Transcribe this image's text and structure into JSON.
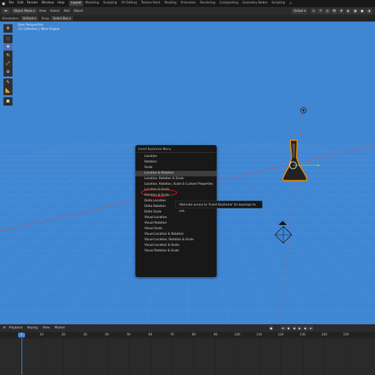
{
  "topbar": {
    "menus": [
      "File",
      "Edit",
      "Render",
      "Window",
      "Help"
    ],
    "workspaces": [
      "Layout",
      "Modeling",
      "Sculpting",
      "UV Editing",
      "Texture Paint",
      "Shading",
      "Animation",
      "Rendering",
      "Compositing",
      "Geometry Nodes",
      "Scripting"
    ],
    "active_workspace": "Layout",
    "add_tab": "+"
  },
  "viewport_header": {
    "mode": "Object Mode",
    "menus": [
      "View",
      "Select",
      "Add",
      "Object"
    ],
    "transform_orientation": "Global"
  },
  "tool_header": {
    "orientation_label": "Orientation:",
    "orientation_value": "Default",
    "drag_label": "Drag:",
    "drag_value": "Select Box"
  },
  "viewport": {
    "perspective": "User Perspective",
    "context": "(1) Collection | Wine Engine",
    "background_color": "#3f86d3"
  },
  "toolbar": {
    "tools": [
      "cursor-icon",
      "select-icon",
      "move-icon",
      "rotate-icon",
      "scale-icon",
      "transform-icon",
      "annotate-icon",
      "measure-icon",
      "add-cube-icon"
    ],
    "active_tool": "move-icon"
  },
  "keyframe_menu": {
    "title": "Insert Keyframe Menu",
    "items": [
      "Location",
      "Rotation",
      "Scale",
      "Location & Rotation",
      "Location, Rotation & Scale",
      "Location, Rotation, Scale & Custom Properties",
      "Location & Scale",
      "Rotation & Scale",
      "Delta Location",
      "Delta Rotation",
      "Delta Scale",
      "Visual Location",
      "Visual Rotation",
      "Visual Scale",
      "Visual Location & Rotation",
      "Visual Location, Rotation & Scale",
      "Visual Location & Scale",
      "Visual Rotation & Scale"
    ],
    "highlighted_index": 3
  },
  "tooltip": {
    "text": "Alternate access to 'Insert Keyframe' for keymaps to use."
  },
  "timeline": {
    "menus": [
      "Playback",
      "Keying",
      "View",
      "Marker"
    ],
    "current_frame": "1",
    "ticks": [
      "10",
      "20",
      "30",
      "40",
      "50",
      "60",
      "70",
      "80",
      "90",
      "100",
      "110",
      "120",
      "130",
      "140",
      "150"
    ],
    "accent_color": "#4b84d6"
  },
  "highlight_color": "#e21e1e"
}
